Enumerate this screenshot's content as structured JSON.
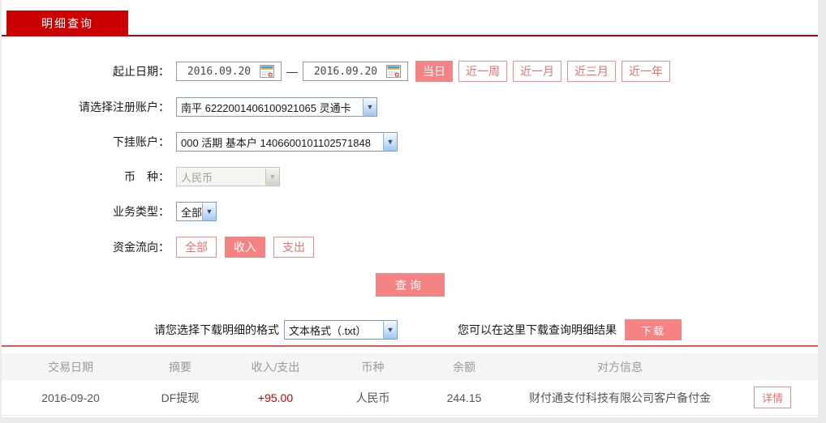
{
  "colors": {
    "brand_red": "#cc0000",
    "accent_salmon": "#f58383",
    "divider_red": "#dc5a52",
    "amount_red": "#c00000"
  },
  "tab": {
    "label": "明细查询"
  },
  "form": {
    "date": {
      "label": "起止日期：",
      "start": "2016.09.20",
      "end": "2016.09.20",
      "separator": "—"
    },
    "quick_ranges": [
      {
        "label": "当日",
        "active": true
      },
      {
        "label": "近一周",
        "active": false
      },
      {
        "label": "近一月",
        "active": false
      },
      {
        "label": "近三月",
        "active": false
      },
      {
        "label": "近一年",
        "active": false
      }
    ],
    "register_account": {
      "label": "请选择注册账户：",
      "value": "南平 6222001406100921065 灵通卡"
    },
    "sub_account": {
      "label": "下挂账户：",
      "value": "000 活期 基本户 1406600101102571848"
    },
    "currency": {
      "label": "币　种：",
      "value": "人民币",
      "disabled": true
    },
    "business_type": {
      "label": "业务类型：",
      "value": "全部"
    },
    "fund_flow": {
      "label": "资金流向：",
      "options": [
        {
          "label": "全部",
          "active": false
        },
        {
          "label": "收入",
          "active": true
        },
        {
          "label": "支出",
          "active": false
        }
      ]
    },
    "query_button": "查询"
  },
  "download": {
    "format_label": "请您选择下载明细的格式",
    "format_value": "文本格式（.txt）",
    "hint": "您可以在这里下载查询明细结果",
    "button": "下载"
  },
  "table": {
    "headers": [
      "交易日期",
      "摘要",
      "收入/支出",
      "币种",
      "余额",
      "对方信息"
    ],
    "rows": [
      {
        "date": "2016-09-20",
        "summary": "DF提现",
        "amount": "+95.00",
        "currency": "人民币",
        "balance": "244.15",
        "counterparty": "财付通支付科技有限公司客户备付金",
        "action": "详情"
      }
    ]
  }
}
